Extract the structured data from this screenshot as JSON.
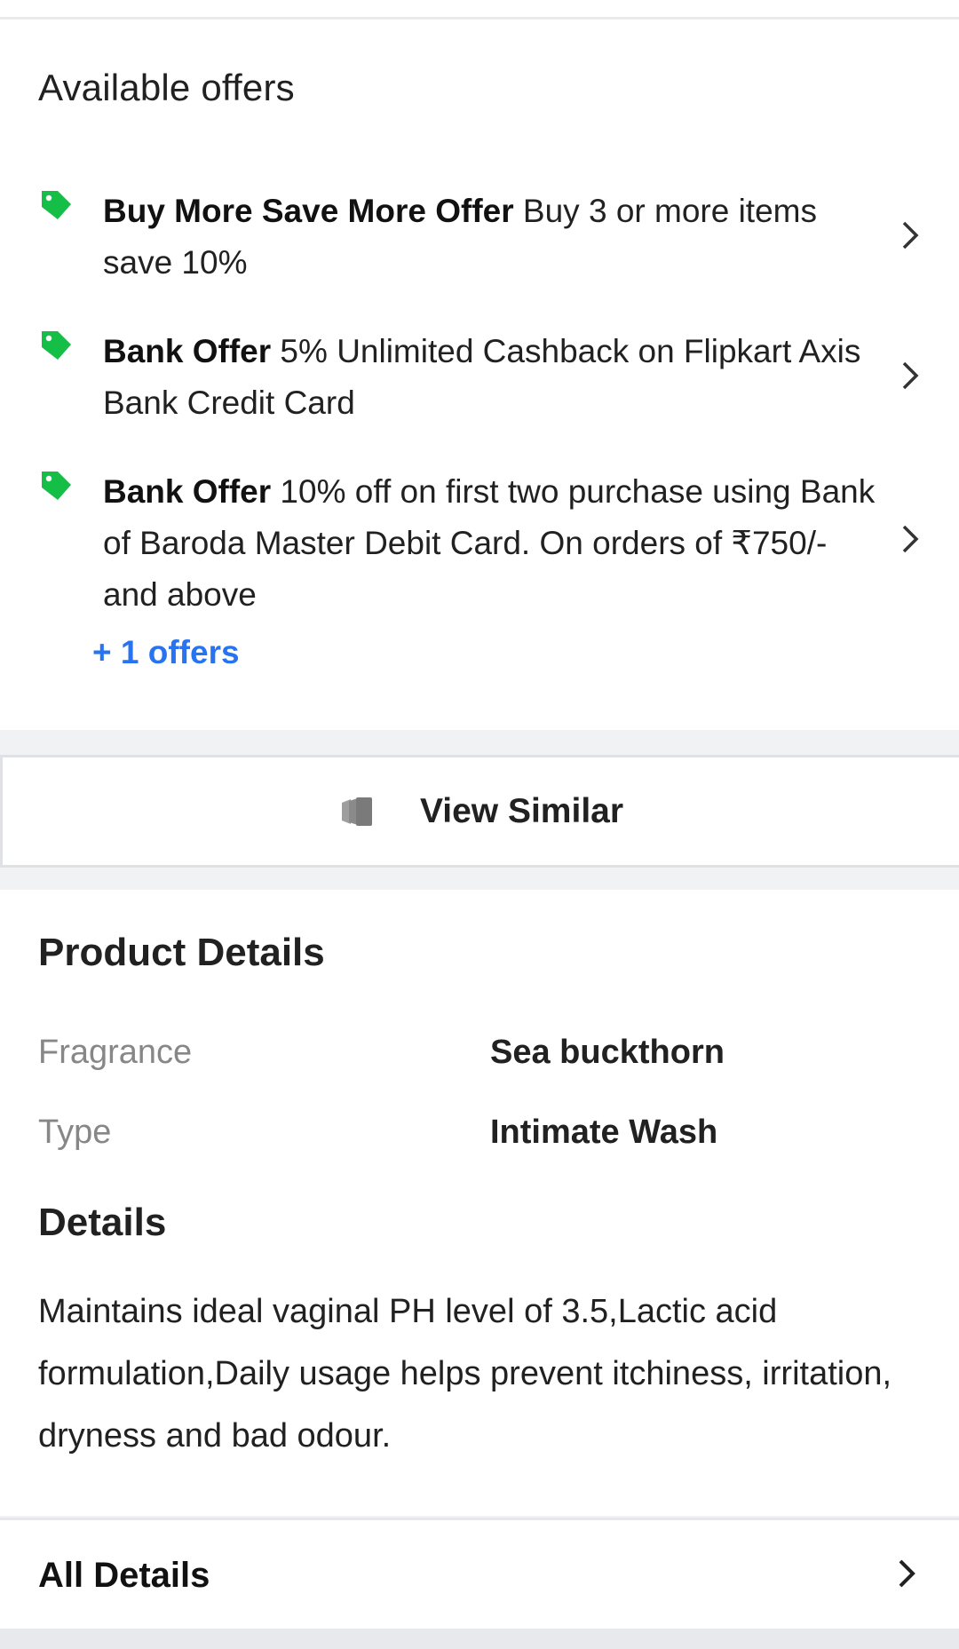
{
  "offers_section": {
    "title": "Available offers",
    "offers": [
      {
        "title": "Buy More Save More Offer",
        "body": " Buy 3 or more items save 10%"
      },
      {
        "title": "Bank Offer",
        "body": " 5% Unlimited Cashback on Flipkart Axis Bank Credit Card"
      },
      {
        "title": "Bank Offer",
        "body": " 10% off on first two purchase using Bank of Baroda Master Debit Card. On orders of ₹750/- and above"
      }
    ],
    "more_offers": "+ 1 offers",
    "tag_color": "#14be47",
    "link_color": "#2874f0"
  },
  "view_similar": {
    "label": "View Similar"
  },
  "product_details": {
    "title": "Product Details",
    "specs": [
      {
        "key": "Fragrance",
        "value": "Sea buckthorn"
      },
      {
        "key": "Type",
        "value": "Intimate Wash"
      }
    ],
    "details_title": "Details",
    "details_text": "Maintains ideal vaginal PH level of 3.5,Lactic acid formulation,Daily usage helps prevent itchiness, irritation, dryness and bad odour."
  },
  "all_details": {
    "label": "All Details"
  }
}
